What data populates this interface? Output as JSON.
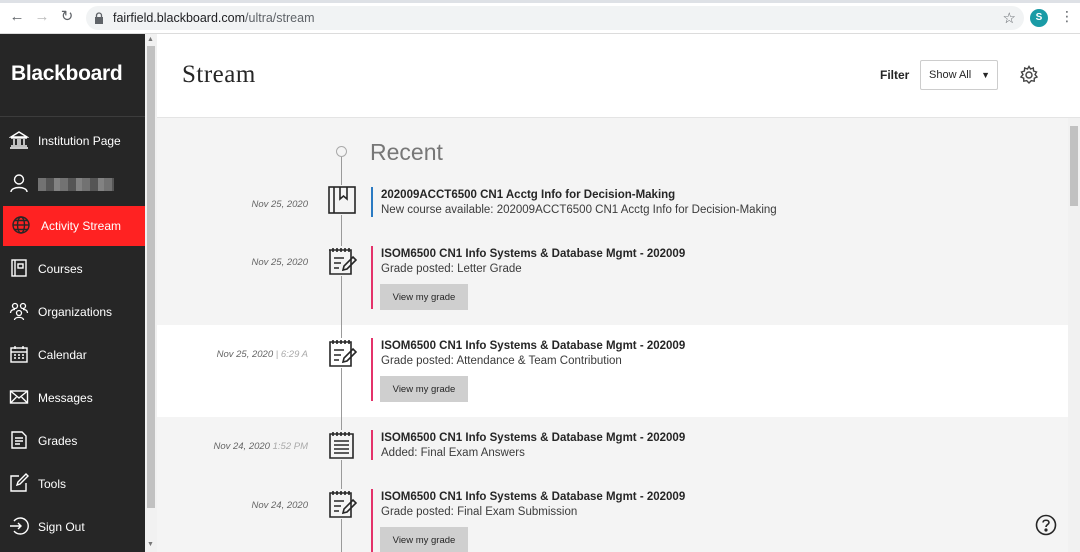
{
  "browser": {
    "url_host": "fairfield.blackboard.com",
    "url_path": "/ultra/stream",
    "avatar_letter": "S"
  },
  "sidebar": {
    "logo": "Blackboard",
    "items": [
      {
        "label": "Institution Page",
        "icon": "institution-icon"
      },
      {
        "label": "",
        "icon": "user-icon",
        "redacted": true
      },
      {
        "label": "Activity Stream",
        "icon": "globe-icon",
        "active": true
      },
      {
        "label": "Courses",
        "icon": "courses-icon"
      },
      {
        "label": "Organizations",
        "icon": "organizations-icon"
      },
      {
        "label": "Calendar",
        "icon": "calendar-icon"
      },
      {
        "label": "Messages",
        "icon": "envelope-icon"
      },
      {
        "label": "Grades",
        "icon": "grades-icon"
      },
      {
        "label": "Tools",
        "icon": "tools-icon"
      },
      {
        "label": "Sign Out",
        "icon": "sign-out-icon"
      }
    ],
    "active_color": "#ff2222"
  },
  "header": {
    "title": "Stream",
    "filter_label": "Filter",
    "filter_value": "Show All"
  },
  "stream": {
    "section_label": "Recent",
    "items": [
      {
        "date": "Nov 25, 2020",
        "time": "",
        "icon": "course-book-icon",
        "accent": "#2a7ac2",
        "title": "202009ACCT6500 CN1 Acctg Info for Decision-Making",
        "subtitle": "New course available: 202009ACCT6500 CN1 Acctg Info for Decision-Making",
        "button": ""
      },
      {
        "date": "Nov 25, 2020",
        "time": "",
        "icon": "grade-icon",
        "accent": "#e4326a",
        "title": "ISOM6500 CN1 Info Systems & Database Mgmt - 202009",
        "subtitle": "Grade posted: Letter Grade",
        "button": "View my grade"
      },
      {
        "date": "Nov 25, 2020",
        "time": "6:29 A",
        "icon": "grade-icon",
        "accent": "#e4326a",
        "title": "ISOM6500 CN1 Info Systems & Database Mgmt - 202009",
        "subtitle": "Grade posted: Attendance & Team Contribution",
        "button": "View my grade"
      },
      {
        "date": "Nov 24, 2020",
        "time": "1:52 PM",
        "icon": "document-icon",
        "accent": "#e4326a",
        "title": "ISOM6500 CN1 Info Systems & Database Mgmt - 202009",
        "subtitle": "Added: Final Exam Answers",
        "button": ""
      },
      {
        "date": "Nov 24, 2020",
        "time": "",
        "icon": "grade-icon",
        "accent": "#e4326a",
        "title": "ISOM6500 CN1 Info Systems & Database Mgmt - 202009",
        "subtitle": "Grade posted: Final Exam Submission",
        "button": "View my grade"
      }
    ]
  }
}
